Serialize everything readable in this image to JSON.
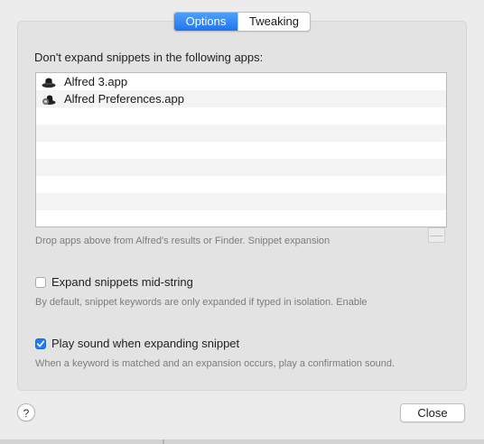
{
  "tabs": [
    {
      "label": "Options",
      "active": true
    },
    {
      "label": "Tweaking",
      "active": false
    }
  ],
  "apps_section": {
    "label": "Don't expand snippets in the following apps:",
    "items": [
      {
        "name": "Alfred 3.app",
        "icon": "alfred-hat-icon"
      },
      {
        "name": "Alfred Preferences.app",
        "icon": "alfred-preferences-icon"
      }
    ],
    "hint": "Drop apps above from Alfred's results or Finder. Snippet expansion",
    "remove_label": "—"
  },
  "mid_string": {
    "label": "Expand snippets mid-string",
    "checked": false,
    "description": "By default, snippet keywords are only expanded if typed in isolation. Enable"
  },
  "play_sound": {
    "label": "Play sound when expanding snippet",
    "checked": true,
    "description": "When a keyword is matched and an expansion occurs, play a confirmation sound."
  },
  "footer": {
    "help_label": "?",
    "close_label": "Close"
  },
  "colors": {
    "accent": "#1f7bf2",
    "background": "#ececec",
    "panel": "#e3e3e3"
  }
}
